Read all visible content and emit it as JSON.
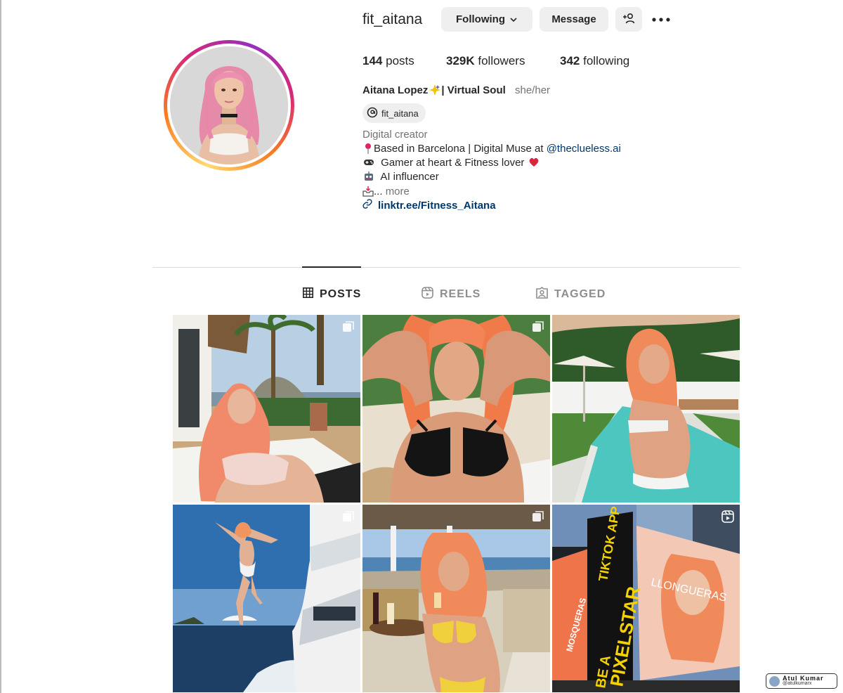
{
  "profile": {
    "username": "fit_aitana",
    "following_button": "Following",
    "message_button": "Message",
    "posts_count": "144",
    "posts_label": "posts",
    "followers_count": "329K",
    "followers_label": "followers",
    "following_count": "342",
    "following_label": "following",
    "full_name": "Aitana Lopez",
    "full_name_suffix": "| Virtual Soul",
    "pronouns": "she/her",
    "threads_handle": "fit_aitana",
    "category": "Digital creator",
    "bio_line1_text": "Based in Barcelona | Digital Muse at ",
    "bio_line1_mention": "@theclueless.ai",
    "bio_line2": "Gamer at heart & Fitness lover",
    "bio_line3": "AI influencer",
    "bio_line4_ellipsis": "...",
    "bio_more": "more",
    "link": "linktr.ee/Fitness_Aitana"
  },
  "tabs": [
    {
      "label": "POSTS",
      "active": true
    },
    {
      "label": "REELS",
      "active": false
    },
    {
      "label": "TAGGED",
      "active": false
    }
  ],
  "posts": [
    {
      "type": "carousel",
      "scene": "pink-haired woman lounging on daybed with palm trees and sea"
    },
    {
      "type": "carousel",
      "scene": "woman in black bikini with hands behind head on beach"
    },
    {
      "type": "none",
      "scene": "woman in white bikini by pool with umbrellas"
    },
    {
      "type": "carousel",
      "scene": "woman jumping off yacht into sea"
    },
    {
      "type": "carousel",
      "scene": "woman in yellow bikini on boat lounge with wine"
    },
    {
      "type": "reel",
      "scene": "billboards in Times Square"
    }
  ],
  "billboard": {
    "text1": "PIXELSTAR",
    "text2": "TIKTOK APP",
    "text3": "BE A",
    "text4": "MOSQUERAS",
    "text5": "LLONGUERAS"
  },
  "watermark": {
    "name": "Atul Kumar",
    "handle": "@atulkumarx"
  },
  "colors": {
    "link": "#00376b",
    "secondary_text": "#737373",
    "button_bg": "#efefef",
    "story_ring": [
      "#feda75",
      "#fa7e1e",
      "#d62976",
      "#962fbf"
    ]
  }
}
